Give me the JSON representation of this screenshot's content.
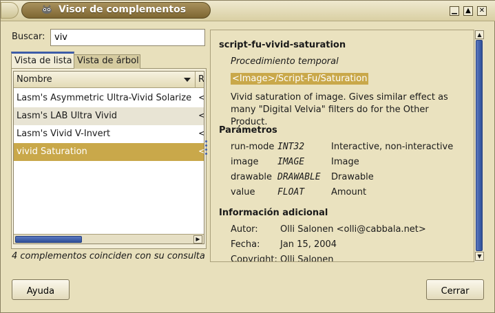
{
  "window": {
    "title": "Visor de complementos",
    "controls": {
      "minimize": "▁",
      "maximize": "▲",
      "close": "✕"
    },
    "icon": "wilber-icon"
  },
  "search": {
    "label": "Buscar:",
    "value": "viv"
  },
  "tabs": [
    {
      "label": "Vista de lista",
      "active": true
    },
    {
      "label": "Vista de árbol",
      "active": false
    }
  ],
  "list": {
    "columns": [
      "Nombre",
      "R"
    ],
    "rows": [
      {
        "name": "Lasm's Asymmetric Ultra-Vivid Solarize",
        "r": "<"
      },
      {
        "name": "Lasm's LAB Ultra Vivid",
        "r": "<"
      },
      {
        "name": "Lasm's Vivid V-Invert",
        "r": "<"
      },
      {
        "name": "vivid Saturation",
        "r": "<",
        "selected": true
      }
    ]
  },
  "status": "4 complementos coinciden con su consulta",
  "info": {
    "proc_name": "script-fu-vivid-saturation",
    "proc_type": "Procedimiento temporal",
    "menu_path": "<Image>/Script-Fu/Saturation",
    "blurb": "Vivid saturation of image. Gives similar effect as many \"Digital Velvia\" filters do for the Other Product.",
    "params_title": "Parámetros",
    "params": [
      {
        "name": "run-mode",
        "type": "INT32",
        "desc": "Interactive, non-interactive"
      },
      {
        "name": "image",
        "type": "IMAGE",
        "desc": "Image"
      },
      {
        "name": "drawable",
        "type": "DRAWABLE",
        "desc": "Drawable"
      },
      {
        "name": "value",
        "type": "FLOAT",
        "desc": "Amount"
      }
    ],
    "additional_title": "Información adicional",
    "additional": [
      {
        "label": "Autor:",
        "value": "Olli Salonen <olli@cabbala.net>"
      },
      {
        "label": "Fecha:",
        "value": "Jan 15, 2004"
      },
      {
        "label": "Copyright:",
        "value": "Olli Salonen"
      }
    ]
  },
  "buttons": {
    "help": "Ayuda",
    "close": "Cerrar"
  },
  "colors": {
    "selection": "#c9a84a",
    "accent": "#3d5ca8",
    "background": "#e8e0bc"
  }
}
